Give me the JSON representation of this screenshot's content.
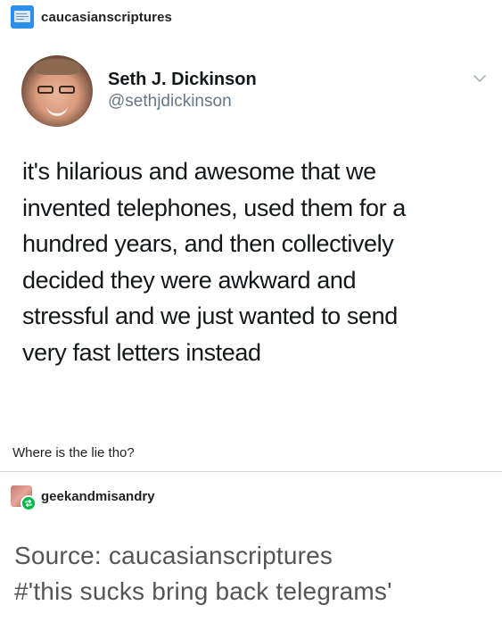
{
  "header": {
    "blog_name": "caucasianscriptures",
    "avatar_icon": "id-card-icon",
    "avatar_color": "#2e8fe8"
  },
  "tweet": {
    "author_name": "Seth J. Dickinson",
    "author_handle": "@sethjdickinson",
    "text": "it's hilarious and awesome that we\ninvented telephones, used them for a\nhundred years, and then collectively\ndecided they were awkward and\nstressful and we just wanted to send\nvery fast letters instead",
    "menu_icon": "chevron-down-icon"
  },
  "caption": "Where is the lie tho?",
  "reblog": {
    "blog_name": "geekandmisandry",
    "badge_icon": "reblog-icon",
    "badge_color": "#00b84a"
  },
  "footer": {
    "source_line": "Source: caucasianscriptures",
    "tag_line": "#'this sucks bring back telegrams'"
  }
}
